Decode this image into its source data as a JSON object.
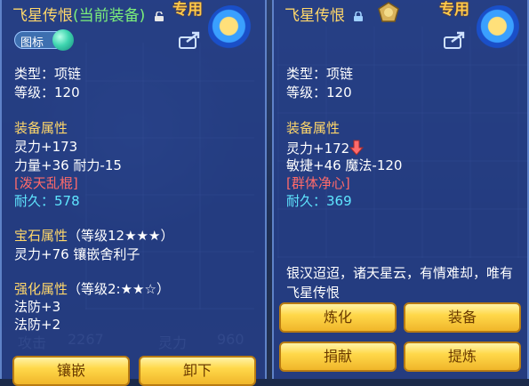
{
  "left_panel": {
    "title": "飞星传恨",
    "title_note": "(当前装备)",
    "exclusive": "专用",
    "pill_label": "图标",
    "type": "类型：项链",
    "level": "等级：120",
    "equip_attr_header": "装备属性",
    "attr_line1": "灵力+173",
    "attr_line2": "力量+36 耐力-15",
    "special": "[泼天乱棍]",
    "durability_label": "耐久：",
    "durability_value": "578",
    "gem_header": "宝石属性",
    "gem_level": "（等级12★★★）",
    "gem_line": "灵力+76 镶嵌舍利子",
    "enhance_header": "强化属性",
    "enhance_level": "（等级2:★★☆）",
    "enhance_line1": "法防+3",
    "enhance_line2": "法防+2",
    "buttons": [
      "镶嵌",
      "卸下"
    ]
  },
  "right_panel": {
    "title": "飞星传恨",
    "exclusive": "专用",
    "type": "类型：项链",
    "level": "等级：120",
    "equip_attr_header": "装备属性",
    "attr_line1": "灵力+172",
    "attr_line2": "敏捷+46 魔法-120",
    "special": "[群体净心]",
    "durability_label": "耐久：",
    "durability_value": "369",
    "flavor_text": "银汉迢迢，诸天星云，有情难却，唯有飞星传恨",
    "buttons": [
      "炼化",
      "装备",
      "捐献",
      "提炼"
    ]
  },
  "background": {
    "bg_stat_labels": [
      "攻击",
      "灵力"
    ],
    "bg_stat_values": [
      "2267",
      "960"
    ]
  },
  "colors": {
    "panel": "#26408a",
    "gold": "#ffd76a",
    "green": "#7cf07a",
    "red": "#ff6a6a",
    "cyan": "#5fe6ff"
  },
  "icons": [
    "lock-icon",
    "share-icon",
    "emblem-icon",
    "badge-icon",
    "down-arrow-icon"
  ]
}
